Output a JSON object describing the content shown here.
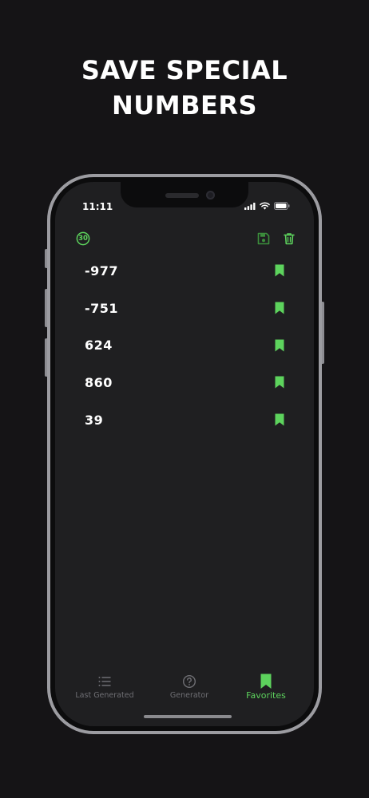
{
  "headline": {
    "line1": "SAVE SPECIAL",
    "line2": "NUMBERS"
  },
  "status_bar": {
    "time": "11:11"
  },
  "toolbar": {
    "count_badge": "30"
  },
  "favorites": [
    {
      "value": "-977"
    },
    {
      "value": "-751"
    },
    {
      "value": "624"
    },
    {
      "value": "860"
    },
    {
      "value": "39"
    }
  ],
  "tabs": [
    {
      "label": "Last Generated",
      "icon": "list-icon"
    },
    {
      "label": "Generator",
      "icon": "question-circle-icon"
    },
    {
      "label": "Favorites",
      "icon": "bookmark-icon",
      "active": true
    }
  ],
  "colors": {
    "accent": "#5dd35d",
    "accent_dim": "#3c8f3c",
    "background": "#151416",
    "screen": "#1f1f21"
  }
}
